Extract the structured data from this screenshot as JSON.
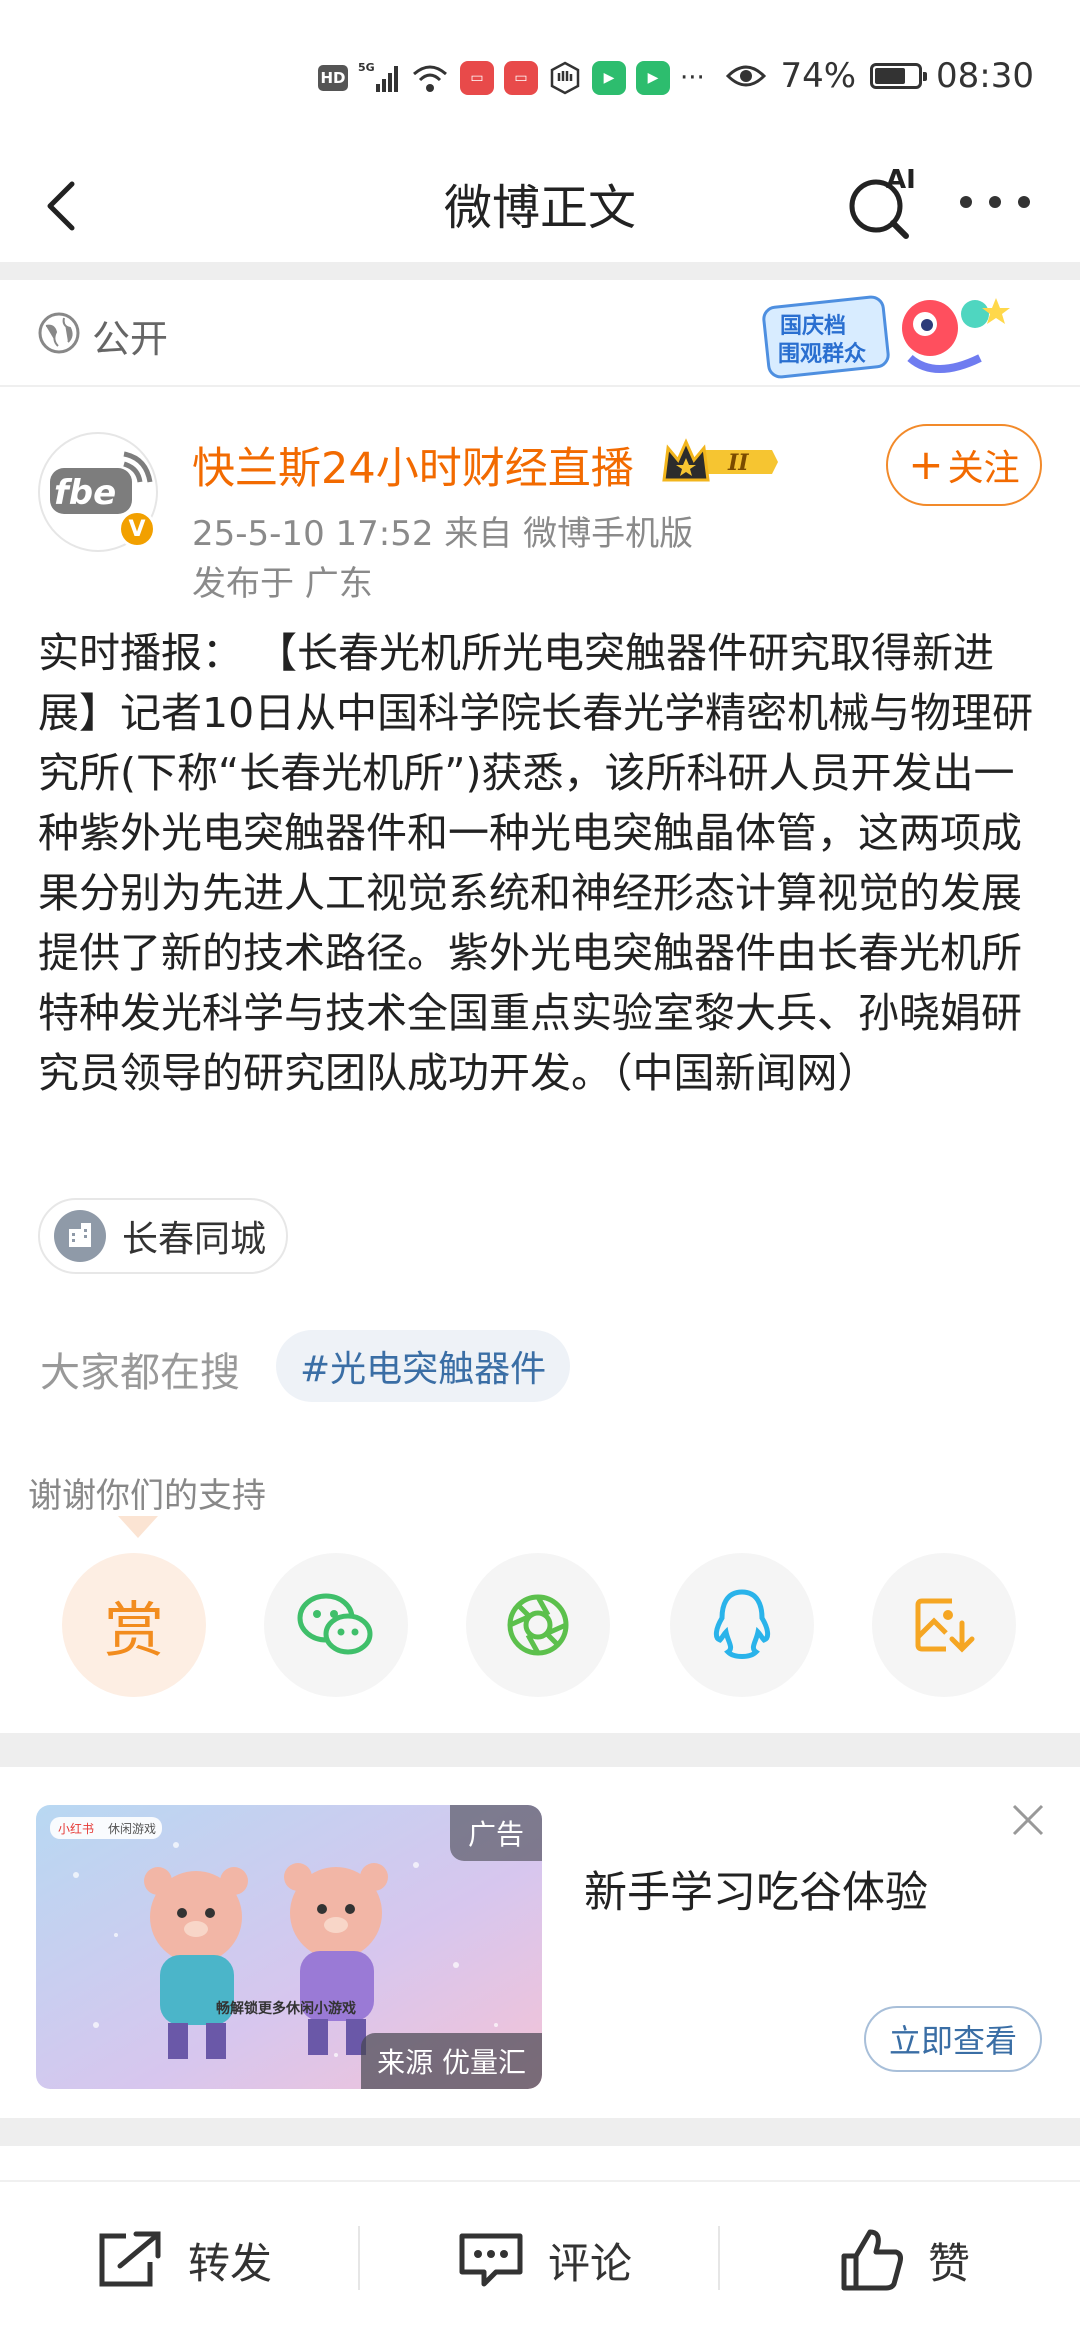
{
  "status_bar": {
    "left_icons": [
      "hd-icon",
      "5g-signal-icon",
      "wifi-icon",
      "huawei-app-icon",
      "huawei-app-icon",
      "hand-icon",
      "video-app-icon",
      "video-app-icon"
    ],
    "hd_label": "HD",
    "network_label": "5G",
    "more_glyph": "···",
    "battery_level": 0.74,
    "battery": "74%",
    "time": "08:30"
  },
  "nav": {
    "title": "微博正文",
    "ai_label": "AI"
  },
  "visibility": {
    "label": "公开",
    "promo_text_line1": "国庆档",
    "promo_text_line2": "围观群众"
  },
  "author": {
    "avatar_text": "fbe",
    "verified_badge": "V",
    "name": "快兰斯24小时财经直播",
    "level_badge": "II",
    "meta": "25-5-10 17:52   来自 微博手机版",
    "location": "发布于 广东",
    "follow_label": "关注"
  },
  "post": {
    "text": "实时播报：  【长春光机所光电突触器件研究取得新进展】记者10日从中国科学院长春光学精密机械与物理研究所(下称“长春光机所”)获悉，该所科研人员开发出一种紫外光电突触器件和一种光电突触晶体管，这两项成果分别为先进人工视觉系统和神经形态计算视觉的发展提供了新的技术路径。紫外光电突触器件由长春光机所特种发光科学与技术全国重点实验室黎大兵、孙晓娟研究员领导的研究团队成功开发。（中国新闻网）",
    "location_tag": "长春同城"
  },
  "search": {
    "label": "大家都在搜",
    "tag": "#光电突触器件"
  },
  "support": {
    "thanks": "谢谢你们的支持",
    "reward_label": "赏",
    "share_icons": [
      "reward-icon",
      "wechat-icon",
      "moments-icon",
      "qq-icon",
      "save-image-icon"
    ]
  },
  "ad": {
    "badge": "广告",
    "source": "来源 优量汇",
    "title": "新手学习吃谷体验",
    "cta": "立即查看",
    "image_brand": "小红书",
    "image_brand_sub": "休闲游戏",
    "image_caption": "畅解锁更多休闲小游戏"
  },
  "toolbar": {
    "repost": "转发",
    "comment": "评论",
    "like": "赞"
  },
  "colors": {
    "accent_orange": "#f26a00",
    "link_blue": "#3a6ea5",
    "divider": "#eeeeee"
  }
}
